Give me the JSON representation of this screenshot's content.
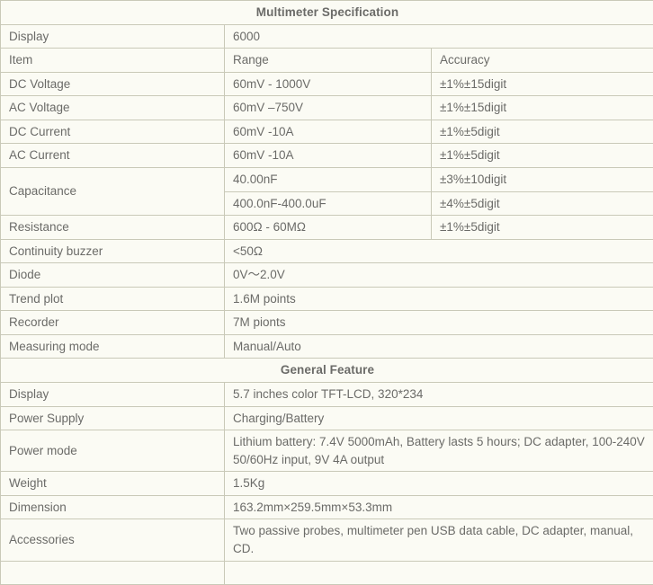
{
  "document": {
    "title": "Multimeter Specification Table"
  },
  "sections": [
    {
      "heading": "Multimeter Specification",
      "columns": [
        "Item",
        "Range",
        "Accuracy"
      ],
      "rows": [
        {
          "item": "Display",
          "range": "6000",
          "accuracy": ""
        },
        {
          "item": "Item",
          "range": "Range",
          "accuracy": "Accuracy"
        },
        {
          "item": "DC Voltage",
          "range": "60mV - 1000V",
          "accuracy": "±1%±15digit"
        },
        {
          "item": "AC Voltage",
          "range": "60mV –750V",
          "accuracy": "±1%±15digit"
        },
        {
          "item": "DC Current",
          "range": "60mV -10A",
          "accuracy": "±1%±5digit"
        },
        {
          "item": "AC Current",
          "range": "60mV -10A",
          "accuracy": "±1%±5digit"
        },
        {
          "item": "Capacitance",
          "range": "40.00nF",
          "accuracy": "±3%±10digit"
        },
        {
          "item": "",
          "range": "400.0nF-400.0uF",
          "accuracy": "±4%±5digit"
        },
        {
          "item": "Resistance",
          "range": "600Ω - 60MΩ",
          "accuracy": "±1%±5digit"
        },
        {
          "item": "Continuity buzzer",
          "range": "<50Ω",
          "accuracy": ""
        },
        {
          "item": "Diode",
          "range": "0V〜2.0V",
          "accuracy": ""
        },
        {
          "item": "Trend plot",
          "range": "1.6M points",
          "accuracy": ""
        },
        {
          "item": "Recorder",
          "range": "7M pionts",
          "accuracy": ""
        },
        {
          "item": "Measuring mode",
          "range": "Manual/Auto",
          "accuracy": ""
        }
      ]
    },
    {
      "heading": "General Feature",
      "rows": [
        {
          "item": "Display",
          "value": "5.7 inches color TFT-LCD, 320*234"
        },
        {
          "item": "Power Supply",
          "value": "Charging/Battery"
        },
        {
          "item": "Power mode",
          "value": "Lithium battery: 7.4V 5000mAh, Battery lasts 5 hours; DC adapter, 100-240V 50/60Hz input, 9V 4A output"
        },
        {
          "item": "Weight",
          "value": "1.5Kg"
        },
        {
          "item": "Dimension",
          "value": "163.2mm×259.5mm×53.3mm"
        },
        {
          "item": "Accessories",
          "value": "Two passive probes, multimeter pen USB data cable, DC adapter, manual, CD."
        }
      ]
    }
  ],
  "colors": {
    "background": "#fbfbf4",
    "border": "#c9c9b8",
    "text": "#6b6b68",
    "heading_text": "#5c5c59"
  }
}
